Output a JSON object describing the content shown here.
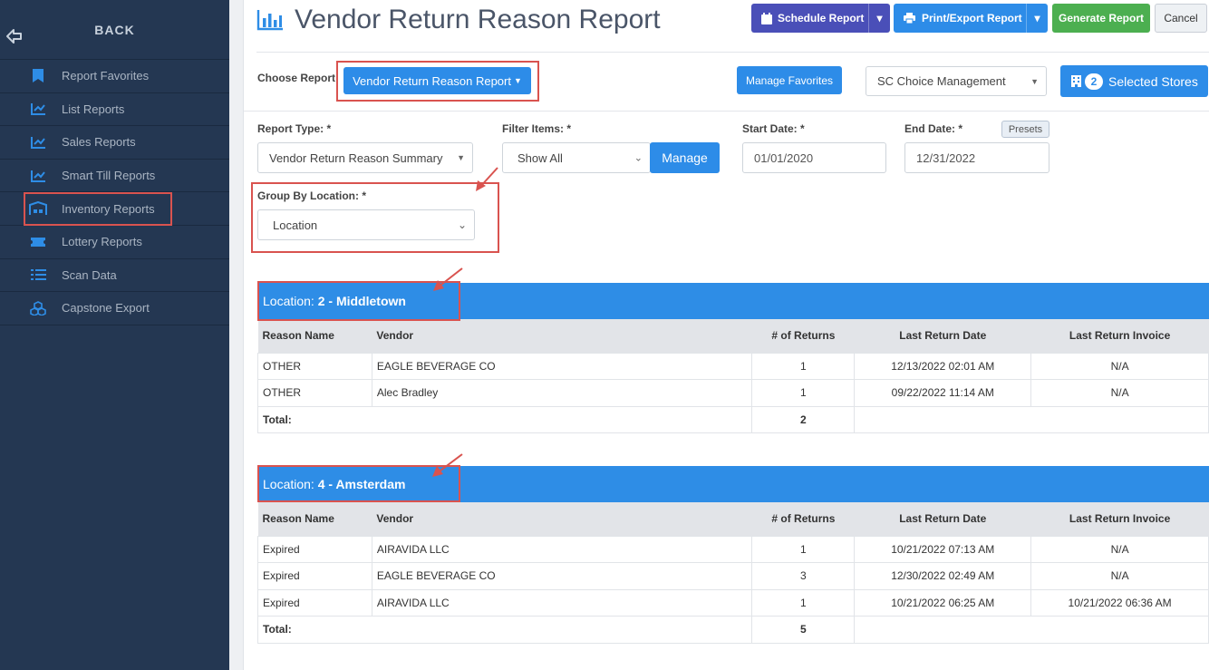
{
  "sidebar": {
    "back_label": "BACK",
    "items": [
      {
        "label": "Report Favorites",
        "icon": "bookmark-icon"
      },
      {
        "label": "List Reports",
        "icon": "line-chart-icon"
      },
      {
        "label": "Sales Reports",
        "icon": "line-chart-icon"
      },
      {
        "label": "Smart Till Reports",
        "icon": "line-chart-icon"
      },
      {
        "label": "Inventory Reports",
        "icon": "warehouse-icon"
      },
      {
        "label": "Lottery Reports",
        "icon": "ticket-icon"
      },
      {
        "label": "Scan Data",
        "icon": "list-icon"
      },
      {
        "label": "Capstone Export",
        "icon": "cubes-icon"
      }
    ]
  },
  "header": {
    "title": "Vendor Return Reason Report",
    "schedule_label": "Schedule Report",
    "print_label": "Print/Export Report",
    "generate_label": "Generate Report",
    "cancel_label": "Cancel"
  },
  "choose": {
    "label": "Choose Report",
    "report_button": "Vendor Return Reason Report",
    "manage_favorites": "Manage Favorites",
    "company": "SC Choice Management",
    "stores_count": "2",
    "stores_label": "Selected Stores"
  },
  "filters": {
    "report_type_label": "Report Type: *",
    "report_type_value": "Vendor Return Reason Summary",
    "filter_items_label": "Filter Items: *",
    "filter_items_value": "Show All",
    "manage_label": "Manage",
    "start_label": "Start Date: *",
    "start_value": "01/01/2020",
    "end_label": "End Date: *",
    "end_value": "12/31/2022",
    "presets_label": "Presets",
    "group_label": "Group By Location: *",
    "group_value": "Location"
  },
  "tables": {
    "columns": [
      "Reason Name",
      "Vendor",
      "# of Returns",
      "Last Return Date",
      "Last Return Invoice"
    ],
    "total_label": "Total:",
    "location_prefix": "Location:",
    "groups": [
      {
        "location": "2 - Middletown",
        "rows": [
          [
            "OTHER",
            "EAGLE BEVERAGE CO",
            "1",
            "12/13/2022 02:01 AM",
            "N/A"
          ],
          [
            "OTHER",
            "Alec Bradley",
            "1",
            "09/22/2022 11:14 AM",
            "N/A"
          ]
        ],
        "total": "2"
      },
      {
        "location": "4 - Amsterdam",
        "rows": [
          [
            "Expired",
            "AIRAVIDA LLC",
            "1",
            "10/21/2022 07:13 AM",
            "N/A"
          ],
          [
            "Expired",
            "EAGLE BEVERAGE CO",
            "3",
            "12/30/2022 02:49 AM",
            "N/A"
          ],
          [
            "Expired",
            "AIRAVIDA LLC",
            "1",
            "10/21/2022 06:25 AM",
            "10/21/2022 06:36 AM"
          ]
        ],
        "total": "5"
      }
    ]
  },
  "colors": {
    "sidebar_bg": "#243752",
    "accent_blue": "#2e8de6",
    "schedule_purple": "#4a4fb8",
    "generate_green": "#4caf50",
    "highlight_red": "#d9534f"
  }
}
